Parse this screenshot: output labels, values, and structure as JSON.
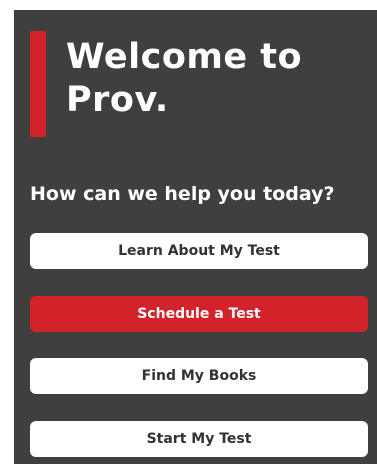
{
  "header": {
    "title": "Welcome to Prov."
  },
  "prompt": "How can we help you today?",
  "actions": [
    {
      "label": "Learn About My Test",
      "style": "secondary"
    },
    {
      "label": "Schedule a Test",
      "style": "primary"
    },
    {
      "label": "Find My Books",
      "style": "secondary"
    },
    {
      "label": "Start My Test",
      "style": "secondary"
    }
  ],
  "colors": {
    "background": "#3f3f3f",
    "accent": "#d2232a",
    "button": "#ffffff",
    "button_text": "#333333"
  }
}
